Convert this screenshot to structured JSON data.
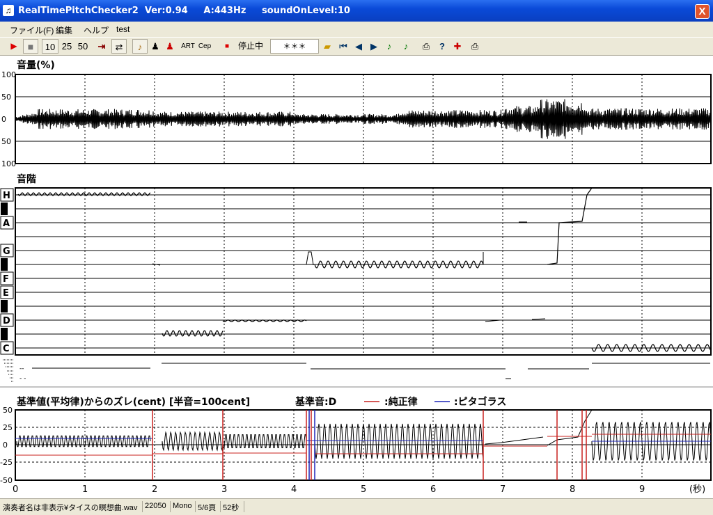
{
  "window": {
    "title": "RealTimePitchChecker2  Ver:0.94     A:443Hz     soundOnLevel:10",
    "close": "X"
  },
  "menu": [
    "ファイル(F)",
    "編集",
    "ヘルプ",
    "test"
  ],
  "toolbar": {
    "speed_options": [
      "10",
      "25",
      "50"
    ],
    "art_label": "ART",
    "cep_label": "Cep",
    "status": "停止中",
    "note_display": "＊＊＊"
  },
  "volume_panel": {
    "title": "音量(%)",
    "y_ticks": [
      "100",
      "50",
      "0",
      "50",
      "100"
    ]
  },
  "scale_panel": {
    "title": "音階",
    "notes": [
      "H",
      "A",
      "G",
      "F",
      "E",
      "D",
      "C"
    ],
    "marks": [
      "--",
      "- -"
    ]
  },
  "cent_panel": {
    "title": "基準値(平均律)からのズレ(cent) [半音=100cent]",
    "ref_note": "基準音:D",
    "legend_just": ":純正律",
    "legend_pyth": ":ピタゴラス",
    "y_ticks": [
      "50",
      "25",
      "0",
      "-25",
      "-50"
    ],
    "x_ticks": [
      "0",
      "1",
      "2",
      "3",
      "4",
      "5",
      "6",
      "7",
      "8",
      "9"
    ],
    "x_unit": "(秒)"
  },
  "colors": {
    "just": "#c8201e",
    "pyth": "#1c24b8",
    "trace": "#000000",
    "grid": "#000000"
  },
  "statusbar": {
    "file": "演奏者名は非表示¥タイスの瞑想曲.wav",
    "rate": "22050",
    "channels": "Mono",
    "page": "5/6頁",
    "duration": "52秒"
  }
}
